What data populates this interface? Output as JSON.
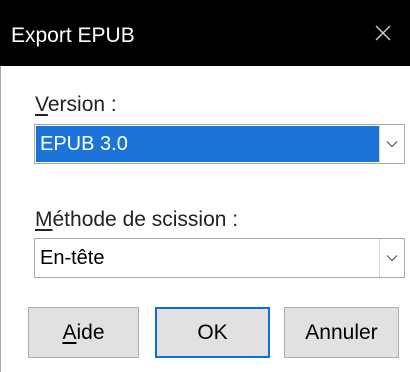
{
  "dialog": {
    "title": "Export EPUB",
    "close_icon": "close-icon"
  },
  "version": {
    "label_mnemonic": "V",
    "label_rest": "ersion :",
    "selected_value": "EPUB 3.0"
  },
  "split": {
    "label_mnemonic": "M",
    "label_rest": "éthode de scission :",
    "selected_value": "En-tête"
  },
  "buttons": {
    "help_mnemonic": "A",
    "help_rest": "ide",
    "ok_label": "OK",
    "cancel_label": "Annuler"
  },
  "colors": {
    "titlebar": "#000000",
    "selection": "#1c74d8",
    "default_button_border": "#0a6fd6"
  }
}
